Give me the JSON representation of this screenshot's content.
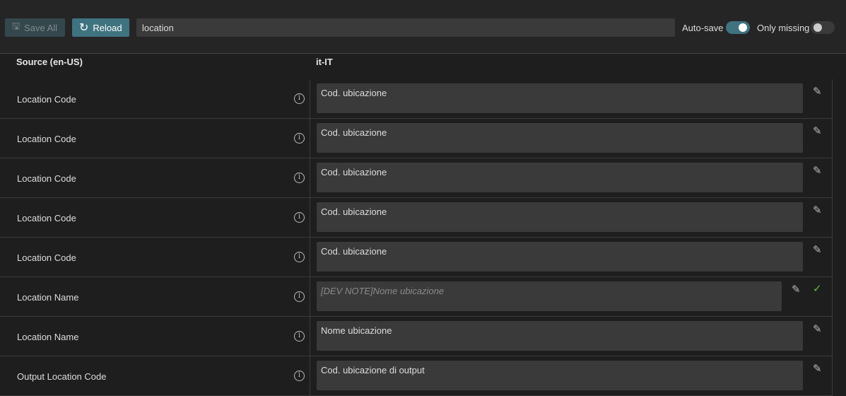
{
  "toolbar": {
    "save_all": "Save All",
    "reload": "Reload",
    "search_value": "location",
    "auto_save_label": "Auto-save",
    "auto_save_on": true,
    "only_missing_label": "Only missing",
    "only_missing_on": false
  },
  "headers": {
    "source": "Source (en-US)",
    "target": "it-IT"
  },
  "rows": [
    {
      "source": "Location Code",
      "translation": "Cod. ubicazione"
    },
    {
      "source": "Location Code",
      "translation": "Cod. ubicazione"
    },
    {
      "source": "Location Code",
      "translation": "Cod. ubicazione"
    },
    {
      "source": "Location Code",
      "translation": "Cod. ubicazione"
    },
    {
      "source": "Location Code",
      "translation": "Cod. ubicazione"
    },
    {
      "source": "Location Name",
      "translation": "",
      "placeholder": "[DEV NOTE]Nome ubicazione",
      "editing": true
    },
    {
      "source": "Location Name",
      "translation": "Nome ubicazione"
    },
    {
      "source": "Output Location Code",
      "translation": "Cod. ubicazione di output"
    }
  ],
  "colors": {
    "accent": "#3f7380",
    "check": "#6cbb3c"
  }
}
